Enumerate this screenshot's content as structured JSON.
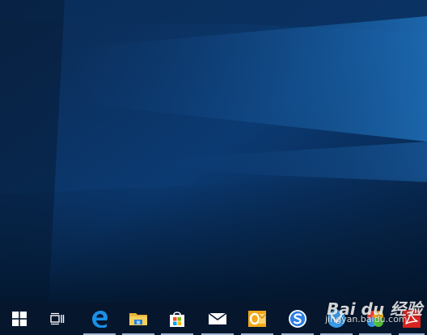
{
  "desktop": {
    "wallpaper": "Windows 10 hero wallpaper (dark blue light beams)",
    "colors": {
      "base": "#0a2a55",
      "beam": "#1f6fb8"
    }
  },
  "taskbar": {
    "background": "#05162d",
    "items": [
      {
        "icon": "windows-start-icon",
        "running": false
      },
      {
        "icon": "task-view-icon",
        "running": false
      },
      {
        "icon": "edge-icon",
        "running": true
      },
      {
        "icon": "file-explorer-icon",
        "running": true
      },
      {
        "icon": "store-icon",
        "running": true
      },
      {
        "icon": "mail-icon",
        "running": true
      },
      {
        "icon": "outlook-icon",
        "running": true
      },
      {
        "icon": "sogou-browser-icon",
        "running": true
      },
      {
        "icon": "app-icon-blue",
        "running": true
      },
      {
        "icon": "app-icon-colorful",
        "running": true
      },
      {
        "icon": "acrobat-icon",
        "running": true
      }
    ]
  },
  "watermark": {
    "logo_text": "Bai du 经验",
    "url": "jingyan.baidu.com"
  }
}
